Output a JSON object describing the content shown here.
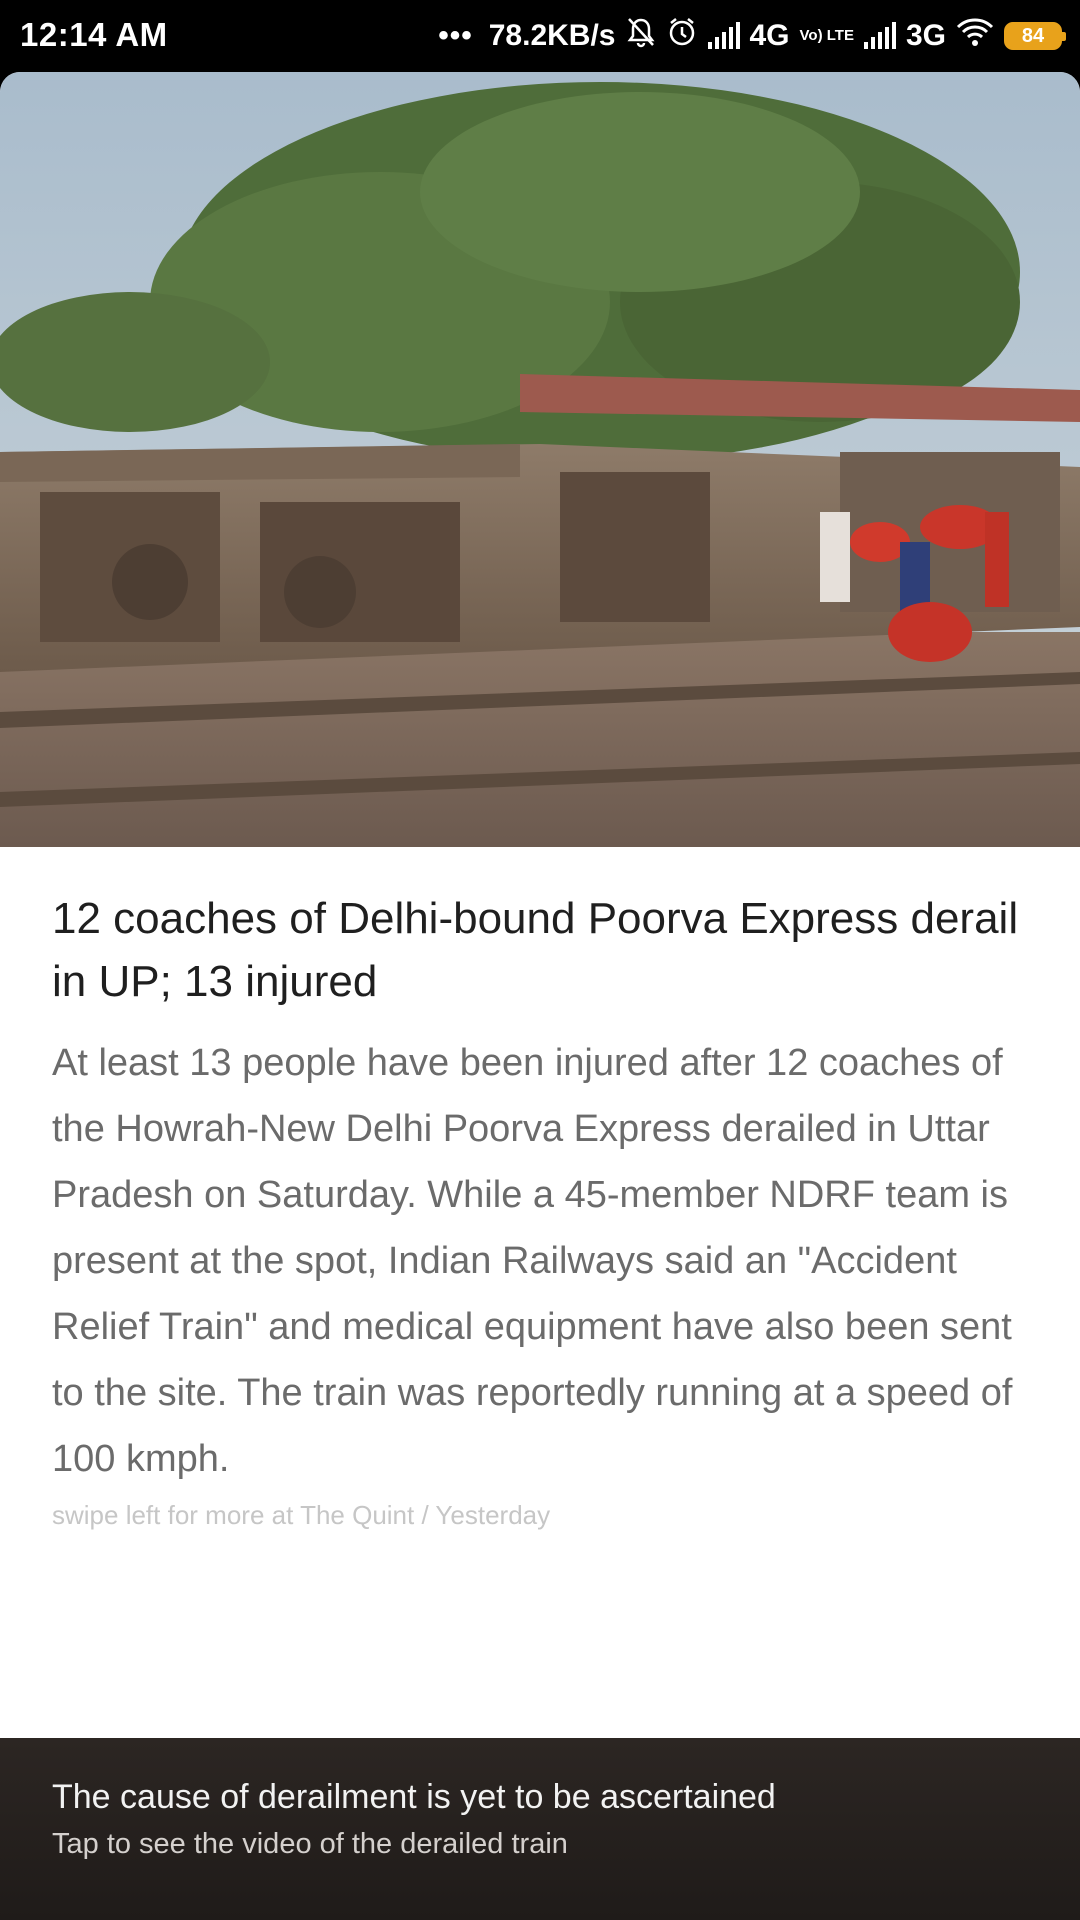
{
  "status_bar": {
    "time": "12:14 AM",
    "dots": "•••",
    "network_speed": "78.2KB/s",
    "network_1": "4G",
    "volte": "Vo) LTE",
    "network_2": "3G",
    "battery": "84",
    "icons": [
      "mute-icon",
      "alarm-icon",
      "signal-icon",
      "signal-icon",
      "wifi-icon",
      "battery-icon"
    ]
  },
  "article": {
    "image_alt": "Derailed train coaches lying on their side beside railway tracks with people gathered nearby",
    "headline": "12 coaches of Delhi-bound Poorva Express derail in UP; 13 injured",
    "body": "At least 13 people have been injured after 12 coaches of the Howrah-New Delhi Poorva Express derailed in Uttar Pradesh on Saturday. While a 45-member NDRF team is present at the spot, Indian Railways said an \"Accident Relief Train\" and medical equipment have also been sent to the site. The train was reportedly running at a speed of 100 kmph.",
    "source_line": "swipe left for more at The Quint / Yesterday"
  },
  "footer": {
    "title": "The cause of derailment is yet to be ascertained",
    "subtitle": "Tap to see the video of the derailed train"
  },
  "colors": {
    "battery": "#e8a21b",
    "headline": "#1f1f1f",
    "body": "#6b6b6b",
    "source": "#c6c6c6",
    "footer_bg": "#2c2623"
  }
}
